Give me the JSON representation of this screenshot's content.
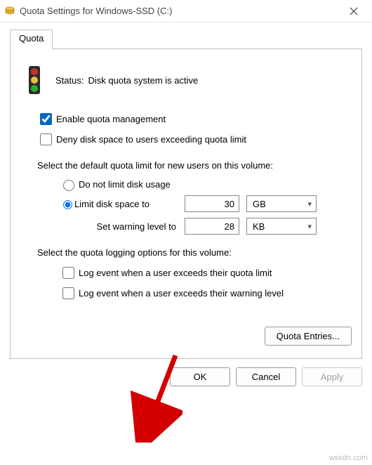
{
  "window": {
    "title": "Quota Settings for Windows-SSD (C:)"
  },
  "tabs": {
    "quota": "Quota"
  },
  "status": {
    "label": "Status:",
    "text": "Disk quota system is active"
  },
  "checks": {
    "enable_quota": "Enable quota management",
    "deny_space": "Deny disk space to users exceeding quota limit"
  },
  "default_limit_section": "Select the default quota limit for new users on this volume:",
  "radios": {
    "no_limit": "Do not limit disk usage",
    "limit_to": "Limit disk space to"
  },
  "limit_row": {
    "value": "30",
    "unit": "GB"
  },
  "warning_row": {
    "label": "Set warning level to",
    "value": "28",
    "unit": "KB"
  },
  "logging_section": "Select the quota logging options for this volume:",
  "log_checks": {
    "exceed_limit": "Log event when a user exceeds their quota limit",
    "exceed_warning": "Log event when a user exceeds their warning level"
  },
  "buttons": {
    "quota_entries": "Quota Entries...",
    "ok": "OK",
    "cancel": "Cancel",
    "apply": "Apply"
  },
  "watermark": "wsxdn.com"
}
